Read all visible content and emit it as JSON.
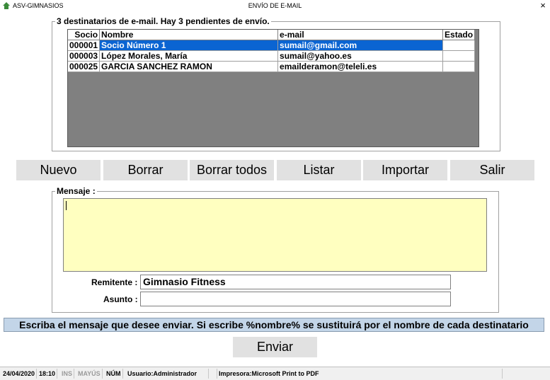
{
  "window": {
    "app_title": "ASV-GIMNASIOS",
    "title": "ENVÍO DE E-MAIL",
    "close_glyph": "×"
  },
  "recipients": {
    "legend": "3 destinatarios de e-mail.  Hay 3 pendientes de envío.",
    "columns": [
      "Socio",
      "Nombre",
      "e-mail",
      "Estado"
    ],
    "rows": [
      {
        "socio": "000001",
        "nombre": "Socio Número 1",
        "email": "sumail@gmail.com",
        "estado": ""
      },
      {
        "socio": "000003",
        "nombre": "López Morales, María",
        "email": "sumail@yahoo.es",
        "estado": ""
      },
      {
        "socio": "000025",
        "nombre": "GARCIA SANCHEZ RAMON",
        "email": "emailderamon@teleli.es",
        "estado": ""
      }
    ]
  },
  "toolbar": {
    "nuevo": "Nuevo",
    "borrar": "Borrar",
    "borrar_todos": "Borrar todos",
    "listar": "Listar",
    "importar": "Importar",
    "salir": "Salir"
  },
  "message": {
    "legend": "Mensaje :",
    "body": "",
    "sender_label": "Remitente :",
    "sender_value": "Gimnasio Fitness",
    "subject_label": "Asunto :",
    "subject_value": ""
  },
  "hint": "Escriba el mensaje que desee enviar. Si escribe %nombre% se sustituirá por el nombre de cada destinatario",
  "send_label": "Enviar",
  "status": {
    "date": "24/04/2020",
    "time": "18:10",
    "ins": "INS",
    "mayus": "MAYÚS",
    "num": "NÚM",
    "user": "Usuario:Administrador",
    "printer": "Impresora:Microsoft Print to PDF"
  },
  "colors": {
    "selection": "#0a64d2",
    "memo_bg": "#ffffc0",
    "hint_bg": "#c3d5e8",
    "grid_bg": "#808080"
  }
}
